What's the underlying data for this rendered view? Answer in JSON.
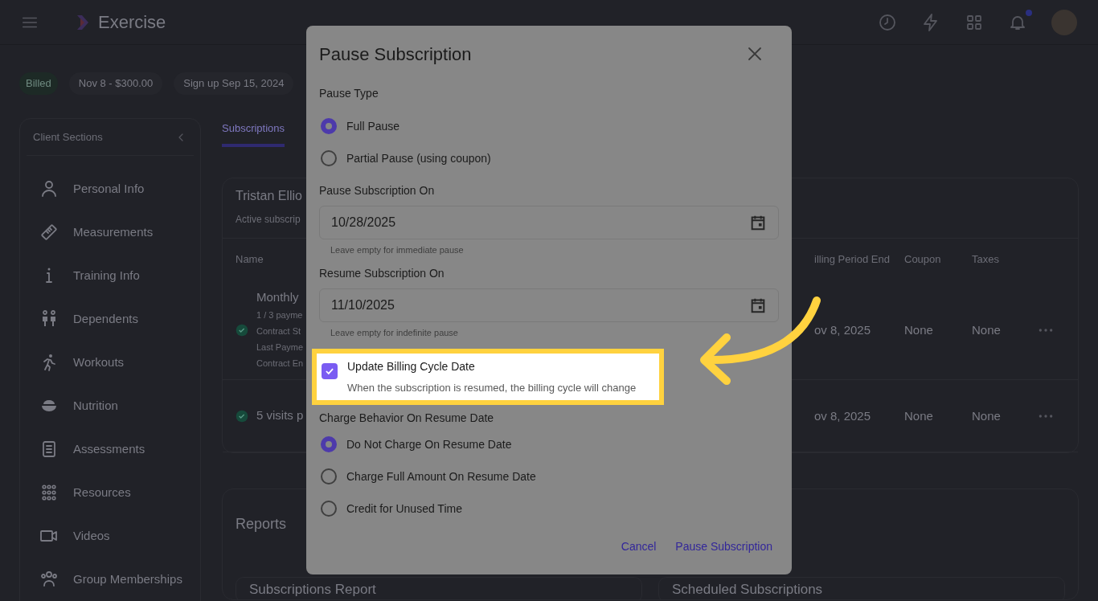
{
  "header": {
    "app_name": "Exercise",
    "notification_unread": true
  },
  "chips": [
    {
      "text": "Billed",
      "kind": "status"
    },
    {
      "text": "Nov 8 - $300.00",
      "kind": "plain"
    },
    {
      "text": "Sign up Sep 15, 2024",
      "kind": "plain"
    }
  ],
  "sidebar": {
    "title": "Client Sections",
    "items": [
      {
        "label": "Personal Info"
      },
      {
        "label": "Measurements"
      },
      {
        "label": "Training Info"
      },
      {
        "label": "Dependents"
      },
      {
        "label": "Workouts"
      },
      {
        "label": "Nutrition"
      },
      {
        "label": "Assessments"
      },
      {
        "label": "Resources"
      },
      {
        "label": "Videos"
      },
      {
        "label": "Group Memberships"
      }
    ]
  },
  "tabs": [
    {
      "label": "Subscriptions",
      "selected": true
    }
  ],
  "subscriptions_card": {
    "title": "Tristan Ellio",
    "subtitle": "Active subscrip",
    "columns": [
      "Name",
      "illing Period End",
      "Coupon",
      "Taxes"
    ],
    "rows": [
      {
        "name": "Monthly",
        "details": [
          "1 / 3 payme",
          "Contract St",
          "Last Payme",
          "Contract En"
        ],
        "period_end": "ov 8, 2025",
        "coupon": "None",
        "taxes": "None",
        "active": true
      },
      {
        "name": "5 visits p",
        "details": [],
        "period_end": "ov 8, 2025",
        "coupon": "None",
        "taxes": "None",
        "active": true
      }
    ]
  },
  "reports": {
    "title": "Reports",
    "cards": [
      "Subscriptions Report",
      "Scheduled Subscriptions"
    ]
  },
  "dialog": {
    "title": "Pause Subscription",
    "pause_type": {
      "label": "Pause Type",
      "options": [
        {
          "label": "Full Pause",
          "selected": true
        },
        {
          "label": "Partial Pause (using coupon)",
          "selected": false
        }
      ]
    },
    "fields": [
      {
        "label": "Pause Subscription On",
        "value": "10/28/2025",
        "hint": "Leave empty for immediate pause"
      },
      {
        "label": "Resume Subscription On",
        "value": "11/10/2025",
        "hint": "Leave empty for indefinite pause"
      }
    ],
    "update_billing": {
      "label": "Update Billing Cycle Date",
      "description": "When the subscription is resumed, the billing cycle will change",
      "checked": true,
      "highlighted": true
    },
    "charge_behavior": {
      "label": "Charge Behavior On Resume Date",
      "options": [
        {
          "label": "Do Not Charge On Resume Date",
          "selected": true
        },
        {
          "label": "Charge Full Amount On Resume Date",
          "selected": false
        },
        {
          "label": "Credit for Unused Time",
          "selected": false
        }
      ]
    },
    "buttons": [
      "Cancel",
      "Pause Subscription"
    ]
  }
}
